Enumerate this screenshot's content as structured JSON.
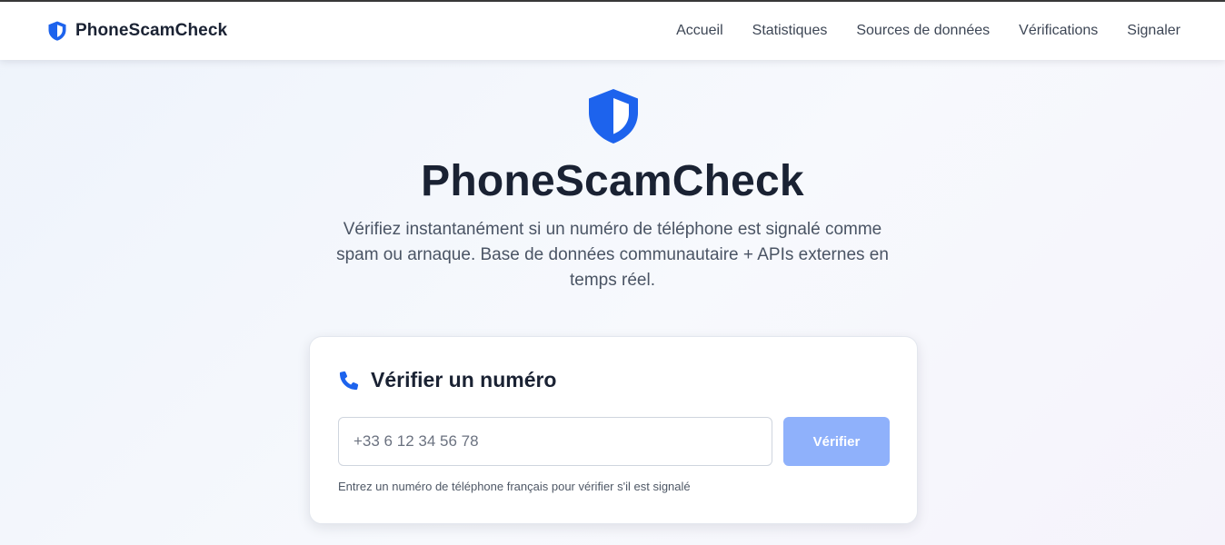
{
  "brand": {
    "name": "PhoneScamCheck",
    "icon": "shield-icon"
  },
  "nav": {
    "items": [
      {
        "label": "Accueil"
      },
      {
        "label": "Statistiques"
      },
      {
        "label": "Sources de données"
      },
      {
        "label": "Vérifications"
      },
      {
        "label": "Signaler"
      }
    ]
  },
  "hero": {
    "icon": "shield-icon",
    "title": "PhoneScamCheck",
    "subtitle": "Vérifiez instantanément si un numéro de téléphone est signalé comme spam ou arnaque. Base de données communautaire + APIs externes en temps réel."
  },
  "check_card": {
    "icon": "phone-icon",
    "title": "Vérifier un numéro",
    "input_value": "",
    "input_placeholder": "+33 6 12 34 56 78",
    "button_label": "Vérifier",
    "helper_text": "Entrez un numéro de téléphone français pour vérifier s'il est signalé"
  },
  "colors": {
    "accent": "#1d63ed",
    "button_disabled": "#8fb1fb",
    "title_text": "#1a2233"
  }
}
